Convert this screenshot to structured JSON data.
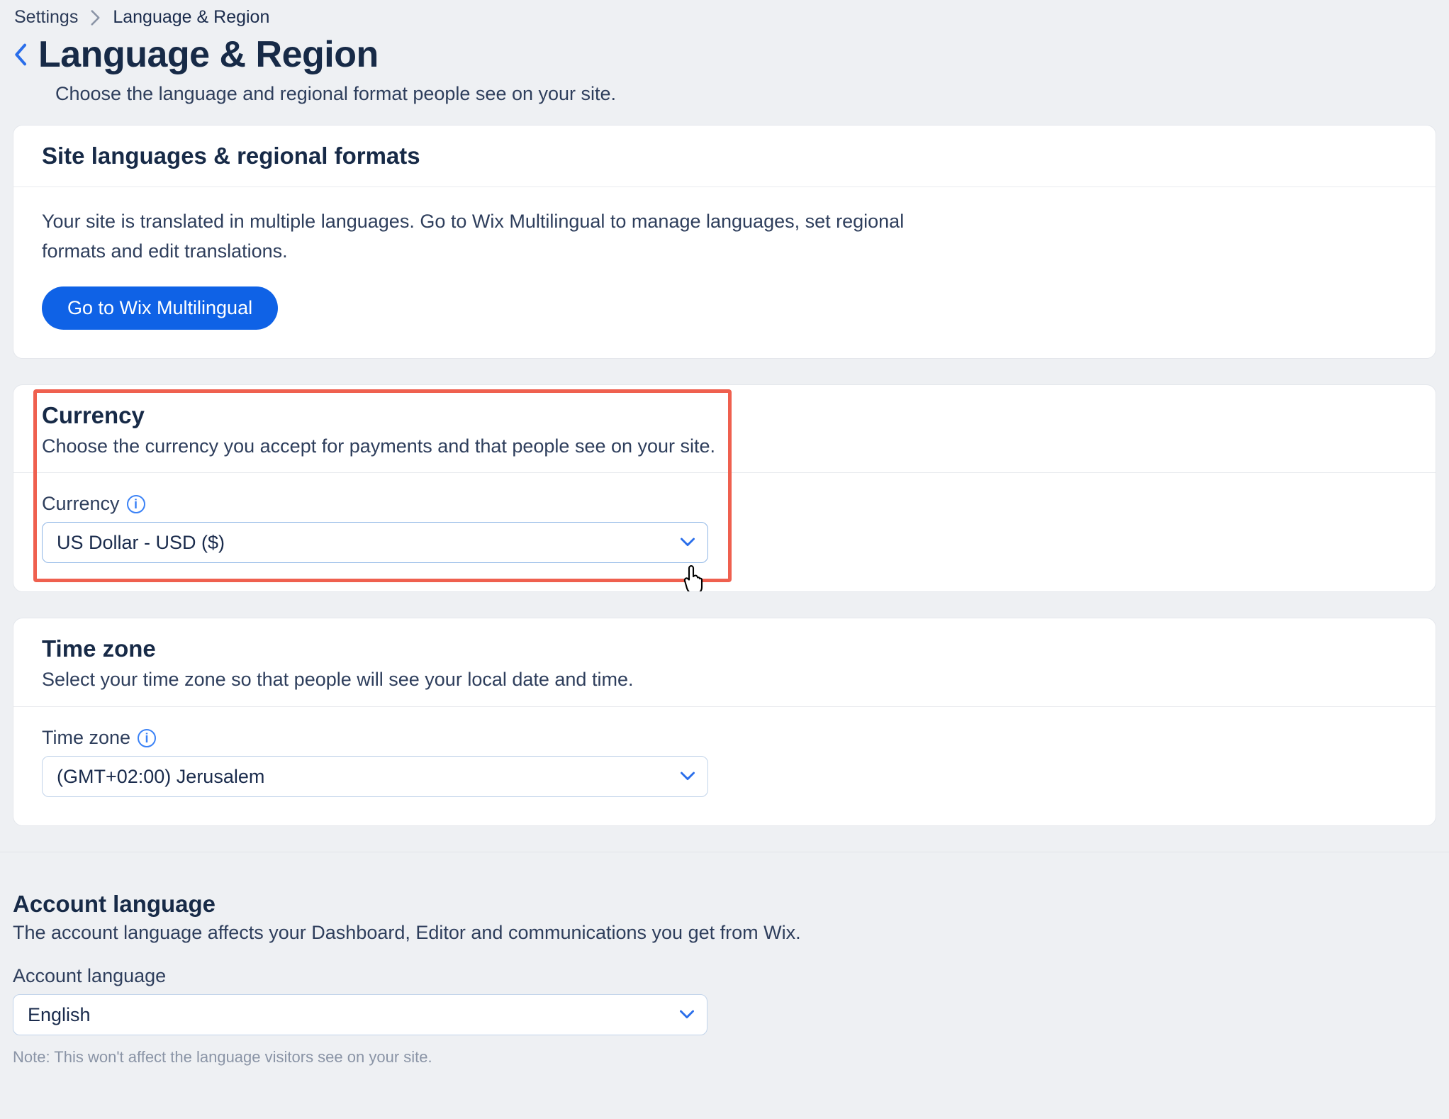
{
  "breadcrumb": {
    "parent": "Settings",
    "current": "Language & Region"
  },
  "header": {
    "title": "Language & Region",
    "subtitle": "Choose the language and regional format people see on your site."
  },
  "card_languages": {
    "title": "Site languages & regional formats",
    "body": "Your site is translated in multiple languages. Go to Wix Multilingual to manage languages, set regional formats and edit translations.",
    "button": "Go to Wix Multilingual"
  },
  "card_currency": {
    "title": "Currency",
    "desc": "Choose the currency you accept for payments and that people see on your site.",
    "field_label": "Currency",
    "value": "US Dollar - USD ($)"
  },
  "card_timezone": {
    "title": "Time zone",
    "desc": "Select your time zone so that people will see your local date and time.",
    "field_label": "Time zone",
    "value": "(GMT+02:00) Jerusalem"
  },
  "account": {
    "title": "Account language",
    "desc": "The account language affects your Dashboard, Editor and communications you get from Wix.",
    "field_label": "Account language",
    "value": "English",
    "note": "Note: This won't affect the language visitors see on your site."
  },
  "colors": {
    "accent": "#0F62E6",
    "highlight": "#ef604f"
  }
}
